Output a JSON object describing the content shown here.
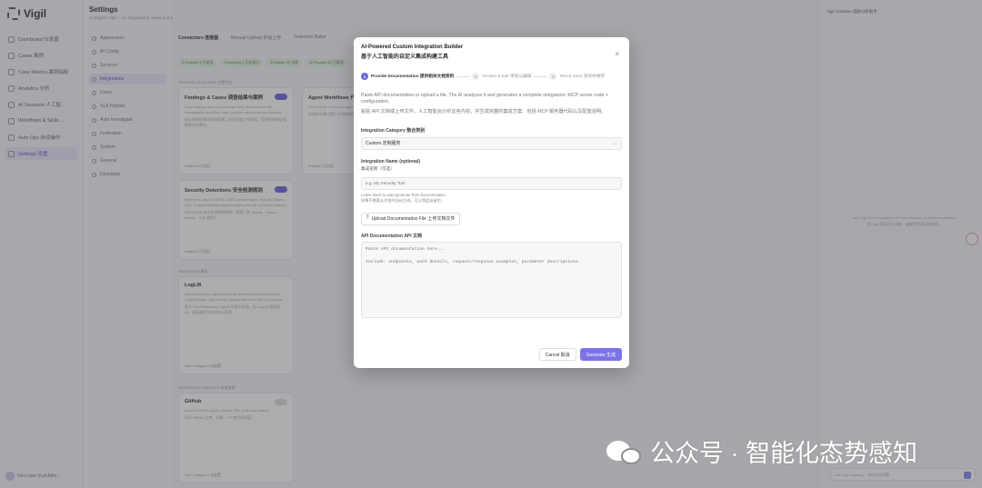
{
  "app": {
    "name": "Vigil"
  },
  "sidebar": {
    "items": [
      {
        "label": "Dashboard 仪表盘"
      },
      {
        "label": "Cases 案例"
      },
      {
        "label": "Case Metrics 案例指标"
      },
      {
        "label": "Analytics 分析"
      },
      {
        "label": "AI Sessions 人工智..."
      },
      {
        "label": "Workflows & Skills ..."
      },
      {
        "label": "Auto Ops 自动操作"
      },
      {
        "label": "Settings 设置"
      }
    ],
    "user": "Dev User (Full Adm..."
  },
  "settings": {
    "title": "Settings",
    "subtitle": "Configure Vigil — AI, integrations, users and platform",
    "items": [
      {
        "label": "Appearance"
      },
      {
        "label": "AI Config"
      },
      {
        "label": "Services"
      },
      {
        "label": "Integrations"
      },
      {
        "label": "Users"
      },
      {
        "label": "SLA Policies"
      },
      {
        "label": "Auto Investigate"
      },
      {
        "label": "Federation"
      },
      {
        "label": "System"
      },
      {
        "label": "General"
      },
      {
        "label": "Developer"
      }
    ]
  },
  "main": {
    "tabs": [
      "Connectors 连接器",
      "Manual Upload 手动上传",
      "Detection Rules"
    ],
    "chips": [
      "3 Enabled 3 已启用",
      "3 Running 3 正在运行",
      "30 Active 30 活跃",
      "10 Paused 10 已暂停"
    ],
    "section_builtin": "INTERNAL PLATFORM 内置平台",
    "section_endpoints": "ENDPOINTS 端点",
    "section_ref": "REFERENCE SOURCES 参考来源",
    "cards": [
      {
        "title": "Findings & Cases 调查结果与案例",
        "desc1": "Core findings and case management. Required for the investigation workflow, case creation, and evidence tracking.",
        "desc2": "核心调查结果和案例管理。这是调查工作流程、案例创建和证据跟踪所必需的。",
        "foot": "Enabled 已启用"
      },
      {
        "title": "Agent Workflows 代理工作流",
        "desc1": "Orchestrate multi-step agent workflows and investigation tasks.",
        "desc2": "协调多步骤代理工作流和调查任务。",
        "foot": "Enabled 已启用"
      },
      {
        "title": "Security Detections 安全检测规则",
        "desc1": "Detection rules for SIEM / XDR across Sigma, Splunk, Elastic, KQL. Enable detection gap analysis and rule recommendations.",
        "desc2": "SIEM/XDR 安全检测规则的统一管理（跨 Sigma、Splunk、Elastic、KQL 格式）。",
        "foot": "Enabled 已启用"
      },
      {
        "title": "LogLM",
        "desc1": "OpenTelemetry LogLM semantic detections powered by the LogLM model. High-fidelity signals streamed into the pipeline.",
        "desc2": "基于 OpenTelemetry LogLM 的语义检测，由 LogLM 模型驱动。高保真信号实时流入管道。",
        "foot": "Not Configured 未配置"
      },
      {
        "title": "GitHub",
        "desc1": "Access GitHub repos, issues, PRs, and code search.",
        "desc2": "访问 GitHub 仓库、问题、PR 和代码搜索。",
        "foot": "Not Configured 未配置"
      }
    ]
  },
  "assistant": {
    "title": "Vigil Assistant 威胁分析助手",
    "msg1": "Ask Vigil for investigation or threat hunting, or create something.",
    "msg2": "向 Vigil 提问进行调查、威胁狩猎或创建内容。",
    "placeholder": "Ask Vigil anything... 询问任何问题"
  },
  "modal": {
    "title": "AI-Powered Custom Integration Builder",
    "title_zh": "基于人工智能的自定义集成构建工具",
    "steps": [
      {
        "num": "1",
        "label": "Provide Documentation 提供相关文档资料"
      },
      {
        "num": "2",
        "label": "Review & Edit 审核与编辑"
      },
      {
        "num": "3",
        "label": "Test & Save 测试并保存"
      }
    ],
    "desc_en": "Paste API documentation or upload a file. The AI analyzes it and generates a complete integration: MCP server code + configuration.",
    "desc_zh": "粘贴 API 文档或上传文件。人工智能会分析这些内容，并生成完整的集成方案：包括 MCP 服务器代码以及配置说明。",
    "category_label": "Integration Category 整合类别",
    "category_value": "Custom 定制服务",
    "name_label": "Integration Name (optional)",
    "name_label_zh": "集成名称（可选）",
    "name_placeholder": "e.g. My Security Tool",
    "name_hint_en": "Leave blank to auto-generate from documentation.",
    "name_hint_zh": "如果不需要从文档中自动生成，可以将此处留空。",
    "upload_label": "Upload Documentation File 上传文档文件",
    "api_doc_label": "API Documentation API 文档",
    "api_doc_placeholder": "Paste API documentation here...\n\nInclude: endpoints, auth details, request/response examples, parameter descriptions.",
    "cancel_label": "Cancel 取消",
    "generate_label": "Generate 生成"
  },
  "watermark": {
    "text": "公众号 · 智能化态势感知"
  },
  "colors": {
    "accent": "#6b65de",
    "overlay": "rgba(60,60,66,0.42)"
  }
}
